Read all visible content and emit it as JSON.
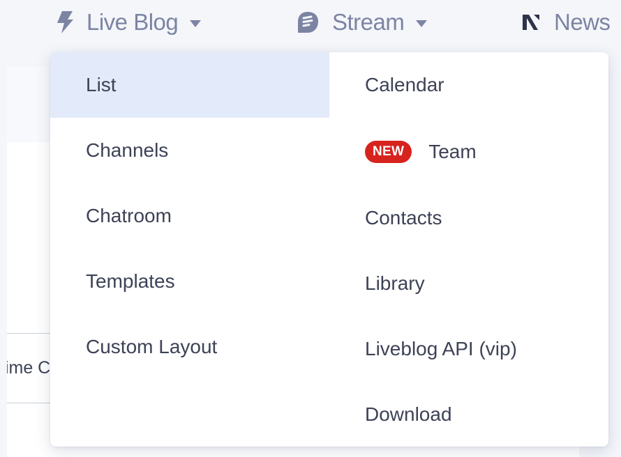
{
  "nav": {
    "live_blog": {
      "label": "Live Blog",
      "icon": "lightning-icon"
    },
    "stream": {
      "label": "Stream",
      "icon": "stream-icon"
    },
    "news": {
      "label": "News",
      "icon": "n-logo-icon"
    }
  },
  "background": {
    "cell_text": "time C"
  },
  "dropdown": {
    "left_items": [
      {
        "label": "List",
        "active": true
      },
      {
        "label": "Channels"
      },
      {
        "label": "Chatroom"
      },
      {
        "label": "Templates"
      },
      {
        "label": "Custom Layout"
      }
    ],
    "right_items": [
      {
        "label": "Calendar"
      },
      {
        "label": "Team",
        "badge": "NEW"
      },
      {
        "label": "Contacts"
      },
      {
        "label": "Library"
      },
      {
        "label": "Liveblog API (vip)"
      },
      {
        "label": "Download"
      }
    ]
  },
  "colors": {
    "nav_text": "#7c84a3",
    "menu_text": "#3d4256",
    "active_bg": "#e3ebfa",
    "badge_bg": "#d7231e"
  }
}
